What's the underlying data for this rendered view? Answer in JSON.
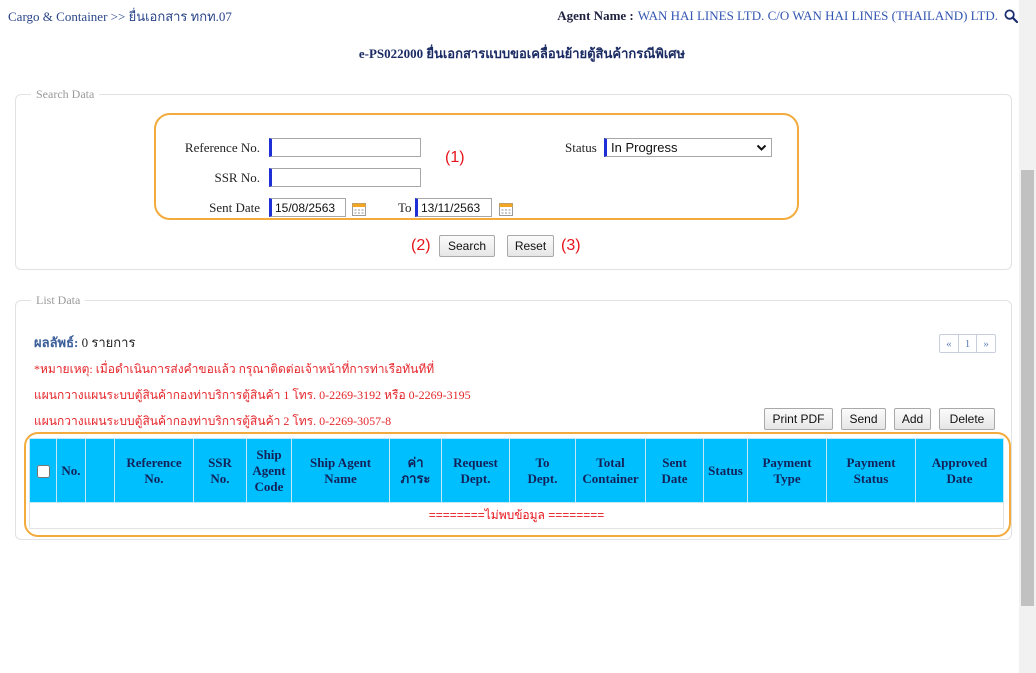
{
  "header": {
    "breadcrumb": "Cargo & Container >> ยื่นเอกสาร ทกท.07",
    "agent_label": "Agent Name :",
    "agent_name": "WAN HAI LINES LTD. C/O WAN HAI LINES (THAILAND) LTD.",
    "search_icon": "search-icon"
  },
  "page_title": "e-PS022000 ยื่นเอกสารแบบขอเคลื่อนย้ายตู้สินค้ากรณีพิเศษ",
  "search": {
    "legend": "Search Data",
    "reference_label": "Reference No.",
    "reference_value": "",
    "ssr_label": "SSR No.",
    "ssr_value": "",
    "sent_date_label": "Sent Date",
    "sent_date_from": "15/08/2563",
    "to_label": "To",
    "sent_date_to": "13/11/2563",
    "status_label": "Status",
    "status_value": "In Progress",
    "calendar_icon": "calendar-icon",
    "dropdown_icon": "chevron-down-icon",
    "search_button": "Search",
    "reset_button": "Reset"
  },
  "annotations": {
    "box_1": "(1)",
    "search_button": "(2)",
    "reset_button": "(3)"
  },
  "list": {
    "legend": "List Data",
    "result_label": "ผลลัพธ์:",
    "result_count": "0 รายการ",
    "pagination": {
      "prev": "«",
      "current": "1",
      "next": "»"
    },
    "notes": [
      "*หมายเหตุ: เมื่อดำเนินการส่งคำขอแล้ว กรุณาติดต่อเจ้าหน้าที่การท่าเรือทันทีที่",
      "แผนกวางแผนระบบตู้สินค้ากองท่าบริการตู้สินค้า 1 โทร. 0-2269-3192 หรือ 0-2269-3195",
      "แผนกวางแผนระบบตู้สินค้ากองท่าบริการตู้สินค้า 2 โทร. 0-2269-3057-8"
    ],
    "buttons": {
      "print_pdf": "Print PDF",
      "send": "Send",
      "add": "Add",
      "delete": "Delete"
    },
    "columns": [
      [],
      [
        "No."
      ],
      [],
      [
        "Reference",
        "No."
      ],
      [
        "SSR",
        "No."
      ],
      [
        "Ship",
        "Agent",
        "Code"
      ],
      [
        "Ship Agent",
        "Name"
      ],
      [
        "ค่า",
        "ภาระ"
      ],
      [
        "Request",
        "Dept."
      ],
      [
        "To",
        "Dept."
      ],
      [
        "Total",
        "Container"
      ],
      [
        "Sent",
        "Date"
      ],
      [
        "Status"
      ],
      [
        "Payment",
        "Type"
      ],
      [
        "Payment",
        "Status"
      ],
      [
        "Approved",
        "Date"
      ]
    ],
    "rows": [],
    "empty_message": "========ไม่พบข้อมูล ========"
  },
  "colors": {
    "annotation_orange": "#f2ab3c",
    "annotation_red": "#e8141c",
    "table_header": "#00bfff",
    "note_red": "#e5262b",
    "input_accent": "#1f2fd6",
    "title_navy": "#1b2b63"
  }
}
